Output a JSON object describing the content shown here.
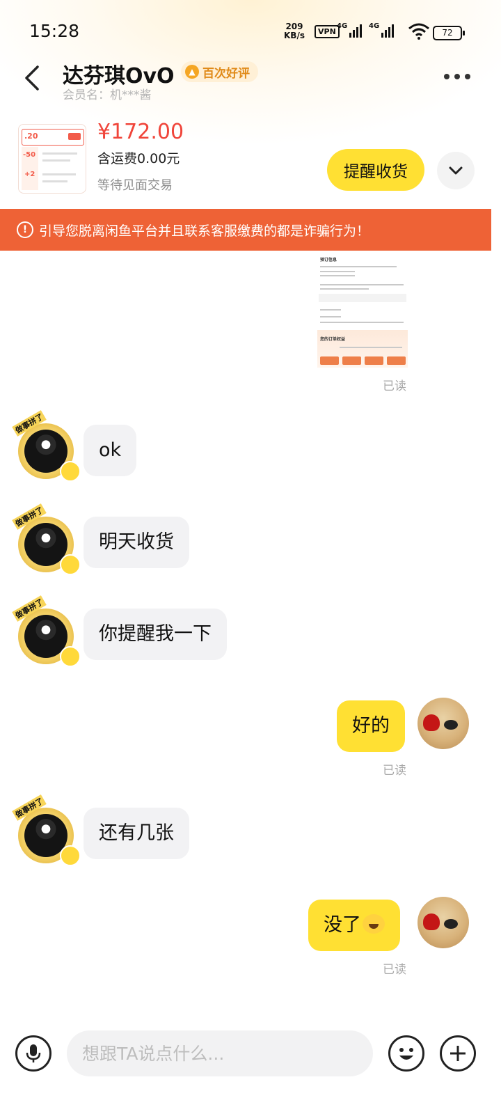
{
  "status_bar": {
    "time": "15:28",
    "speed_value": "209",
    "speed_unit": "KB/s",
    "vpn": "VPN",
    "net1": "4G",
    "net2": "4G",
    "battery": "72"
  },
  "header": {
    "title": "达芬琪OvO",
    "badge": "百次好评",
    "member": "会员名：机***酱"
  },
  "product": {
    "price": "¥172.00",
    "shipping": "含运费0.00元",
    "status": "等待见面交易",
    "remind_button": "提醒收货",
    "thumb_text1": "-50",
    "thumb_text2": "+2",
    "thumb_text3": ".20"
  },
  "warning": "引导您脱离闲鱼平台并且联系客服缴费的都是诈骗行为！",
  "messages": {
    "read_label": "已读",
    "m1": "ok",
    "m2": "明天收货",
    "m3": "你提醒我一下",
    "m4": "好的",
    "m5": "还有几张",
    "m6": "没了"
  },
  "shared_image": {
    "title": "预订信息",
    "section": "您的订单权益"
  },
  "avatar_tag": "做事拼了",
  "input": {
    "placeholder": "想跟TA说点什么..."
  },
  "colors": {
    "accent_yellow": "#ffe033",
    "price_red": "#f0453a",
    "warning_orange": "#ee6236"
  }
}
